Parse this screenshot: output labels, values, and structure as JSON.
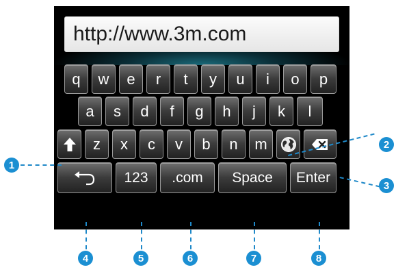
{
  "url_field": {
    "value": "http://www.3m.com"
  },
  "keyboard": {
    "row1": [
      "q",
      "w",
      "e",
      "r",
      "t",
      "y",
      "u",
      "i",
      "o",
      "p"
    ],
    "row2": [
      "a",
      "s",
      "d",
      "f",
      "g",
      "h",
      "j",
      "k",
      "l"
    ],
    "row3": [
      "z",
      "x",
      "c",
      "v",
      "b",
      "n",
      "m"
    ],
    "bottom": {
      "numbers_label": "123",
      "dotcom_label": ".com",
      "space_label": "Space",
      "enter_label": "Enter"
    },
    "icons": {
      "shift": "shift-arrow-up-icon",
      "globe": "globe-icon",
      "backspace": "backspace-icon",
      "back": "return-arrow-icon"
    }
  },
  "callouts": [
    "1",
    "2",
    "3",
    "4",
    "5",
    "6",
    "7",
    "8"
  ],
  "colors": {
    "callout": "#1b8fd2",
    "key_text": "#ffffff",
    "background": "#000000"
  }
}
